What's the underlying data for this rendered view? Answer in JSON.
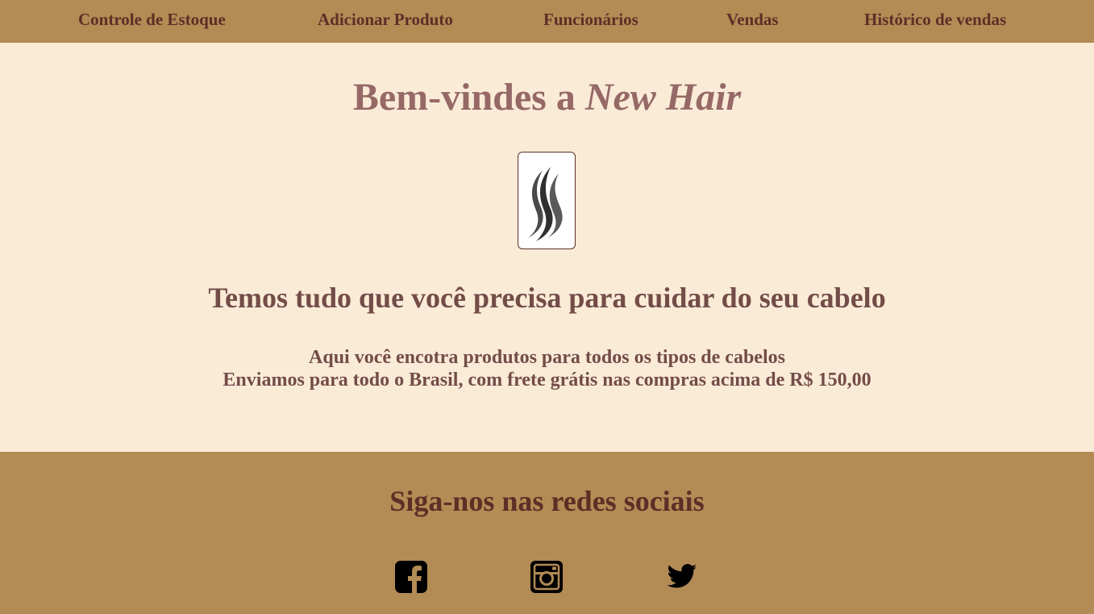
{
  "nav": {
    "items": [
      {
        "label": "Controle de Estoque"
      },
      {
        "label": "Adicionar Produto"
      },
      {
        "label": "Funcionários"
      },
      {
        "label": "Vendas"
      },
      {
        "label": "Histórico de vendas"
      }
    ]
  },
  "main": {
    "welcome_prefix": "Bem-vindes a ",
    "welcome_brand": "New Hair",
    "tagline": "Temos tudo que você precisa para cuidar do seu cabelo",
    "description_line1": "Aqui você encotra produtos para todos os tipos de cabelos",
    "description_line2": "Enviamos para todo o Brasil, com frete grátis nas compras acima de R$ 150,00",
    "logo_icon": "hair-strands-icon"
  },
  "footer": {
    "title": "Siga-nos nas redes sociais",
    "social": [
      {
        "icon": "facebook-icon"
      },
      {
        "icon": "instagram-icon"
      },
      {
        "icon": "twitter-icon"
      }
    ]
  },
  "colors": {
    "bar": "#B38B55",
    "background": "#FAEBD7",
    "nav_text": "#5C2F26",
    "welcome_text": "#966966",
    "body_text": "#734C48"
  }
}
